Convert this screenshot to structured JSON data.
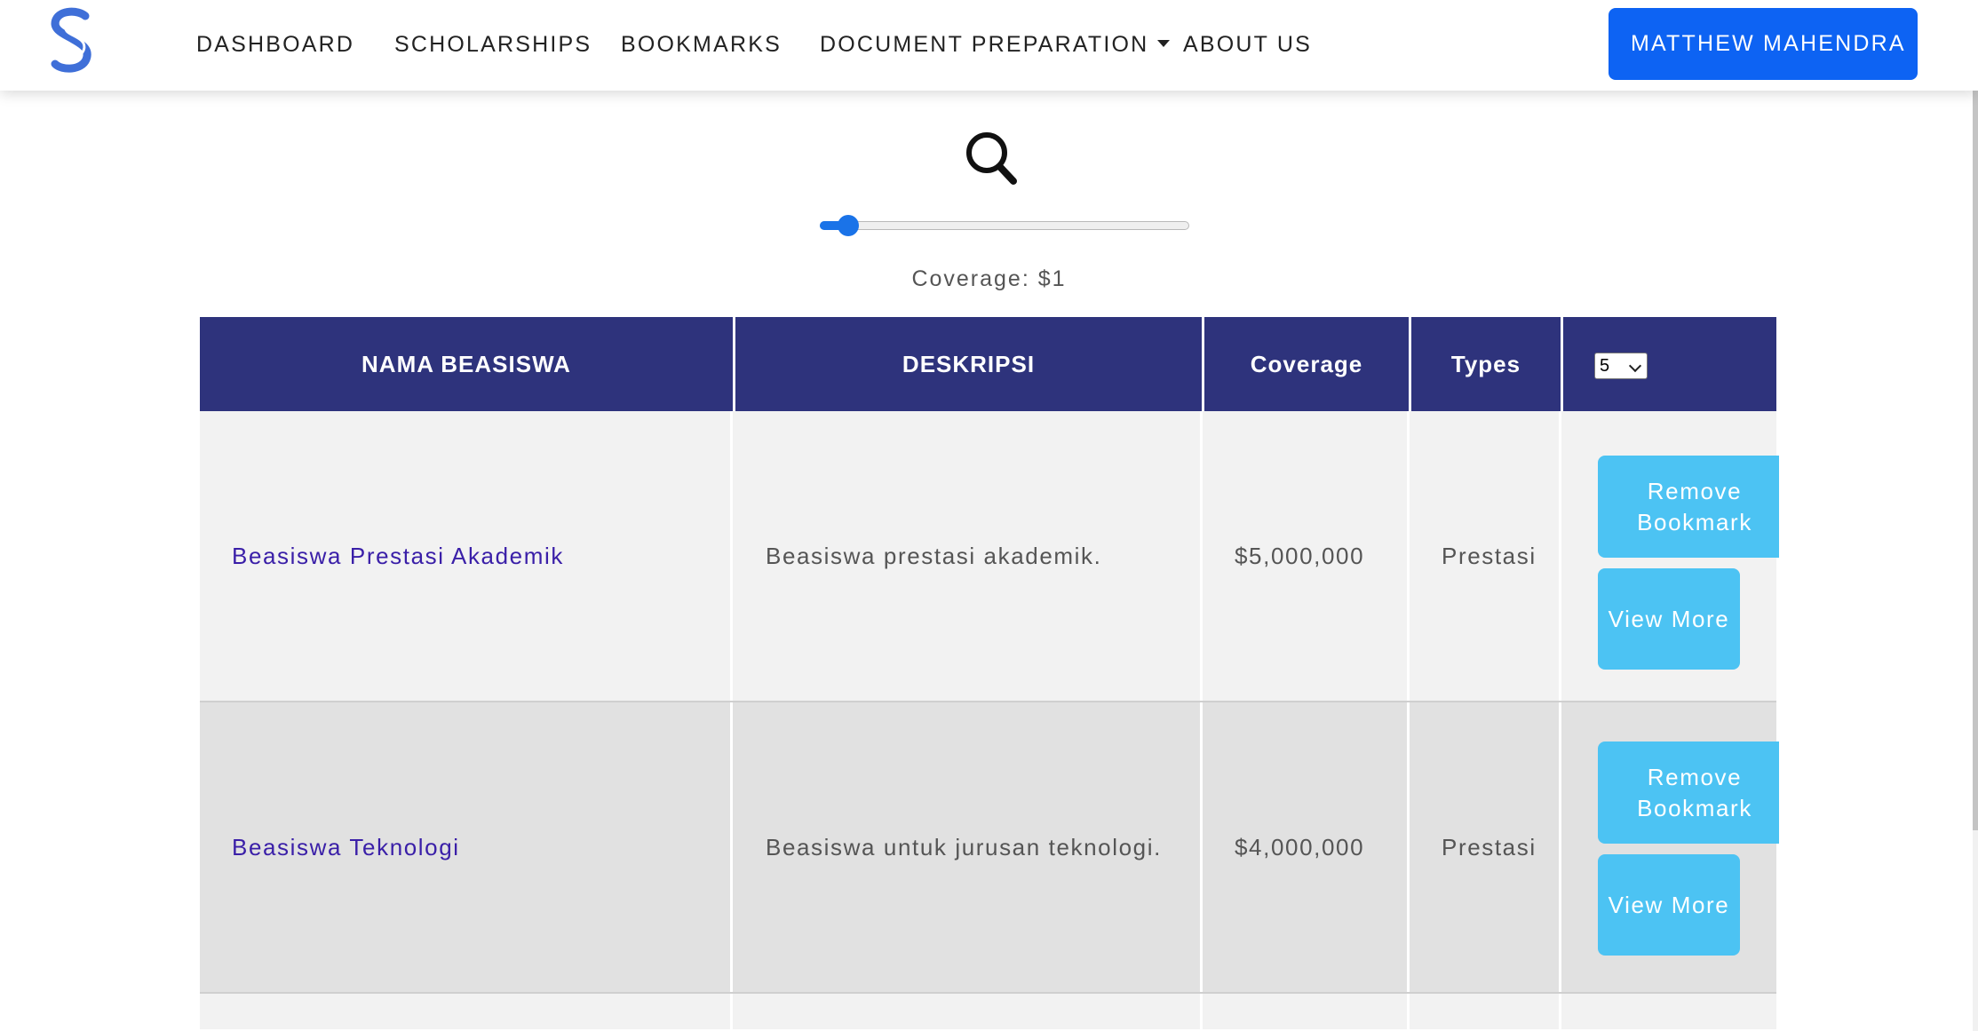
{
  "nav": {
    "items": [
      "DASHBOARD",
      "SCHOLARSHIPS",
      "BOOKMARKS",
      "DOCUMENT PREPARATION",
      "ABOUT US"
    ],
    "user_label": "MATTHEW MAHENDRA"
  },
  "filter": {
    "coverage_label": "Coverage: $1",
    "slider_value_fraction": 0.05
  },
  "table": {
    "headers": [
      "NAMA BEASISWA",
      "DESKRIPSI",
      "Coverage",
      "Types"
    ],
    "page_size": "5",
    "rows": [
      {
        "name": "Beasiswa Prestasi Akademik",
        "description": "Beasiswa prestasi akademik.",
        "coverage": "$5,000,000",
        "type": "Prestasi",
        "remove_label": "Remove Bookmark",
        "view_label": "View More"
      },
      {
        "name": "Beasiswa Teknologi",
        "description": "Beasiswa untuk jurusan teknologi.",
        "coverage": "$4,000,000",
        "type": "Prestasi",
        "remove_label": "Remove Bookmark",
        "view_label": "View More"
      }
    ]
  },
  "colors": {
    "header_bg": "#2e337c",
    "primary_button": "#0d63f3",
    "action_button": "#4cc3f3",
    "link_text": "#3a1fa8",
    "row_odd": "#f2f2f2",
    "row_even": "#e1e1e1",
    "logo": "#3f6fd8"
  },
  "icons": {
    "logo": "brand-s-logo",
    "search": "search-icon",
    "dropdown": "caret-down-icon"
  }
}
